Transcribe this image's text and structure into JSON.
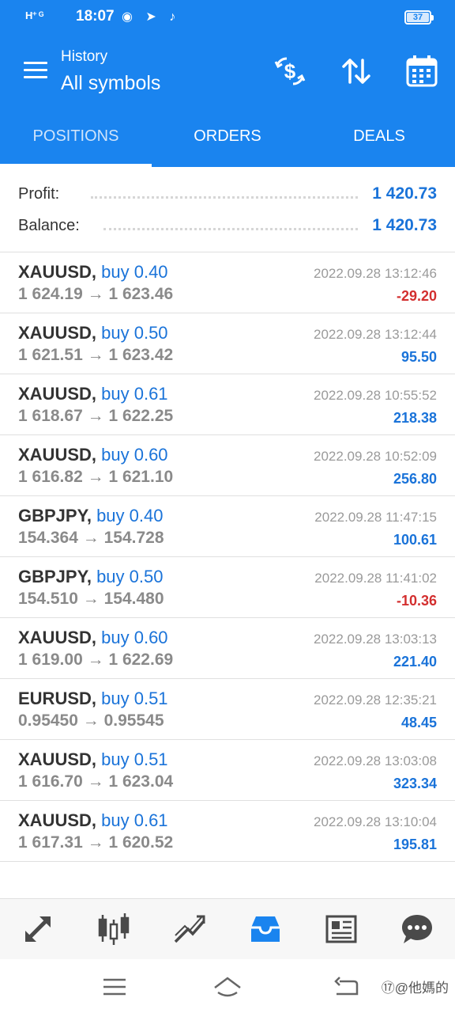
{
  "status_bar": {
    "signal_text": "H⁺ ᴳ",
    "time": "18:07",
    "battery": "37"
  },
  "toolbar": {
    "title": "History",
    "subtitle": "All symbols"
  },
  "tabs": [
    {
      "label": "POSITIONS"
    },
    {
      "label": "ORDERS"
    },
    {
      "label": "DEALS"
    }
  ],
  "summary": {
    "profit_label": "Profit:",
    "profit_value": "1 420.73",
    "balance_label": "Balance:",
    "balance_value": "1 420.73"
  },
  "deals": [
    {
      "symbol": "XAUUSD,",
      "side": "buy 0.40",
      "open": "1 624.19",
      "arrow": "→",
      "close": "1 623.46",
      "datetime": "2022.09.28 13:12:46",
      "profit": "-29.20",
      "negative": true
    },
    {
      "symbol": "XAUUSD,",
      "side": "buy 0.50",
      "open": "1 621.51",
      "arrow": "→",
      "close": "1 623.42",
      "datetime": "2022.09.28 13:12:44",
      "profit": "95.50",
      "negative": false
    },
    {
      "symbol": "XAUUSD,",
      "side": "buy 0.61",
      "open": "1 618.67",
      "arrow": "→",
      "close": "1 622.25",
      "datetime": "2022.09.28 10:55:52",
      "profit": "218.38",
      "negative": false
    },
    {
      "symbol": "XAUUSD,",
      "side": "buy 0.60",
      "open": "1 616.82",
      "arrow": "→",
      "close": "1 621.10",
      "datetime": "2022.09.28 10:52:09",
      "profit": "256.80",
      "negative": false
    },
    {
      "symbol": "GBPJPY,",
      "side": "buy 0.40",
      "open": "154.364",
      "arrow": "→",
      "close": "154.728",
      "datetime": "2022.09.28 11:47:15",
      "profit": "100.61",
      "negative": false
    },
    {
      "symbol": "GBPJPY,",
      "side": "buy 0.50",
      "open": "154.510",
      "arrow": "→",
      "close": "154.480",
      "datetime": "2022.09.28 11:41:02",
      "profit": "-10.36",
      "negative": true
    },
    {
      "symbol": "XAUUSD,",
      "side": "buy 0.60",
      "open": "1 619.00",
      "arrow": "→",
      "close": "1 622.69",
      "datetime": "2022.09.28 13:03:13",
      "profit": "221.40",
      "negative": false
    },
    {
      "symbol": "EURUSD,",
      "side": "buy 0.51",
      "open": "0.95450",
      "arrow": "→",
      "close": "0.95545",
      "datetime": "2022.09.28 12:35:21",
      "profit": "48.45",
      "negative": false
    },
    {
      "symbol": "XAUUSD,",
      "side": "buy 0.51",
      "open": "1 616.70",
      "arrow": "→",
      "close": "1 623.04",
      "datetime": "2022.09.28 13:03:08",
      "profit": "323.34",
      "negative": false
    },
    {
      "symbol": "XAUUSD,",
      "side": "buy 0.61",
      "open": "1 617.31",
      "arrow": "→",
      "close": "1 620.52",
      "datetime": "2022.09.28 13:10:04",
      "profit": "195.81",
      "negative": false
    }
  ],
  "bottom_nav": [
    {
      "icon": "quotes-icon"
    },
    {
      "icon": "chart-icon"
    },
    {
      "icon": "trade-icon"
    },
    {
      "icon": "history-icon",
      "active": true
    },
    {
      "icon": "news-icon"
    },
    {
      "icon": "chat-icon"
    }
  ],
  "watermark": "⑰@他媽的",
  "colors": {
    "primary": "#1a84ef",
    "positive": "#1a73d9",
    "negative": "#d32f2f"
  }
}
